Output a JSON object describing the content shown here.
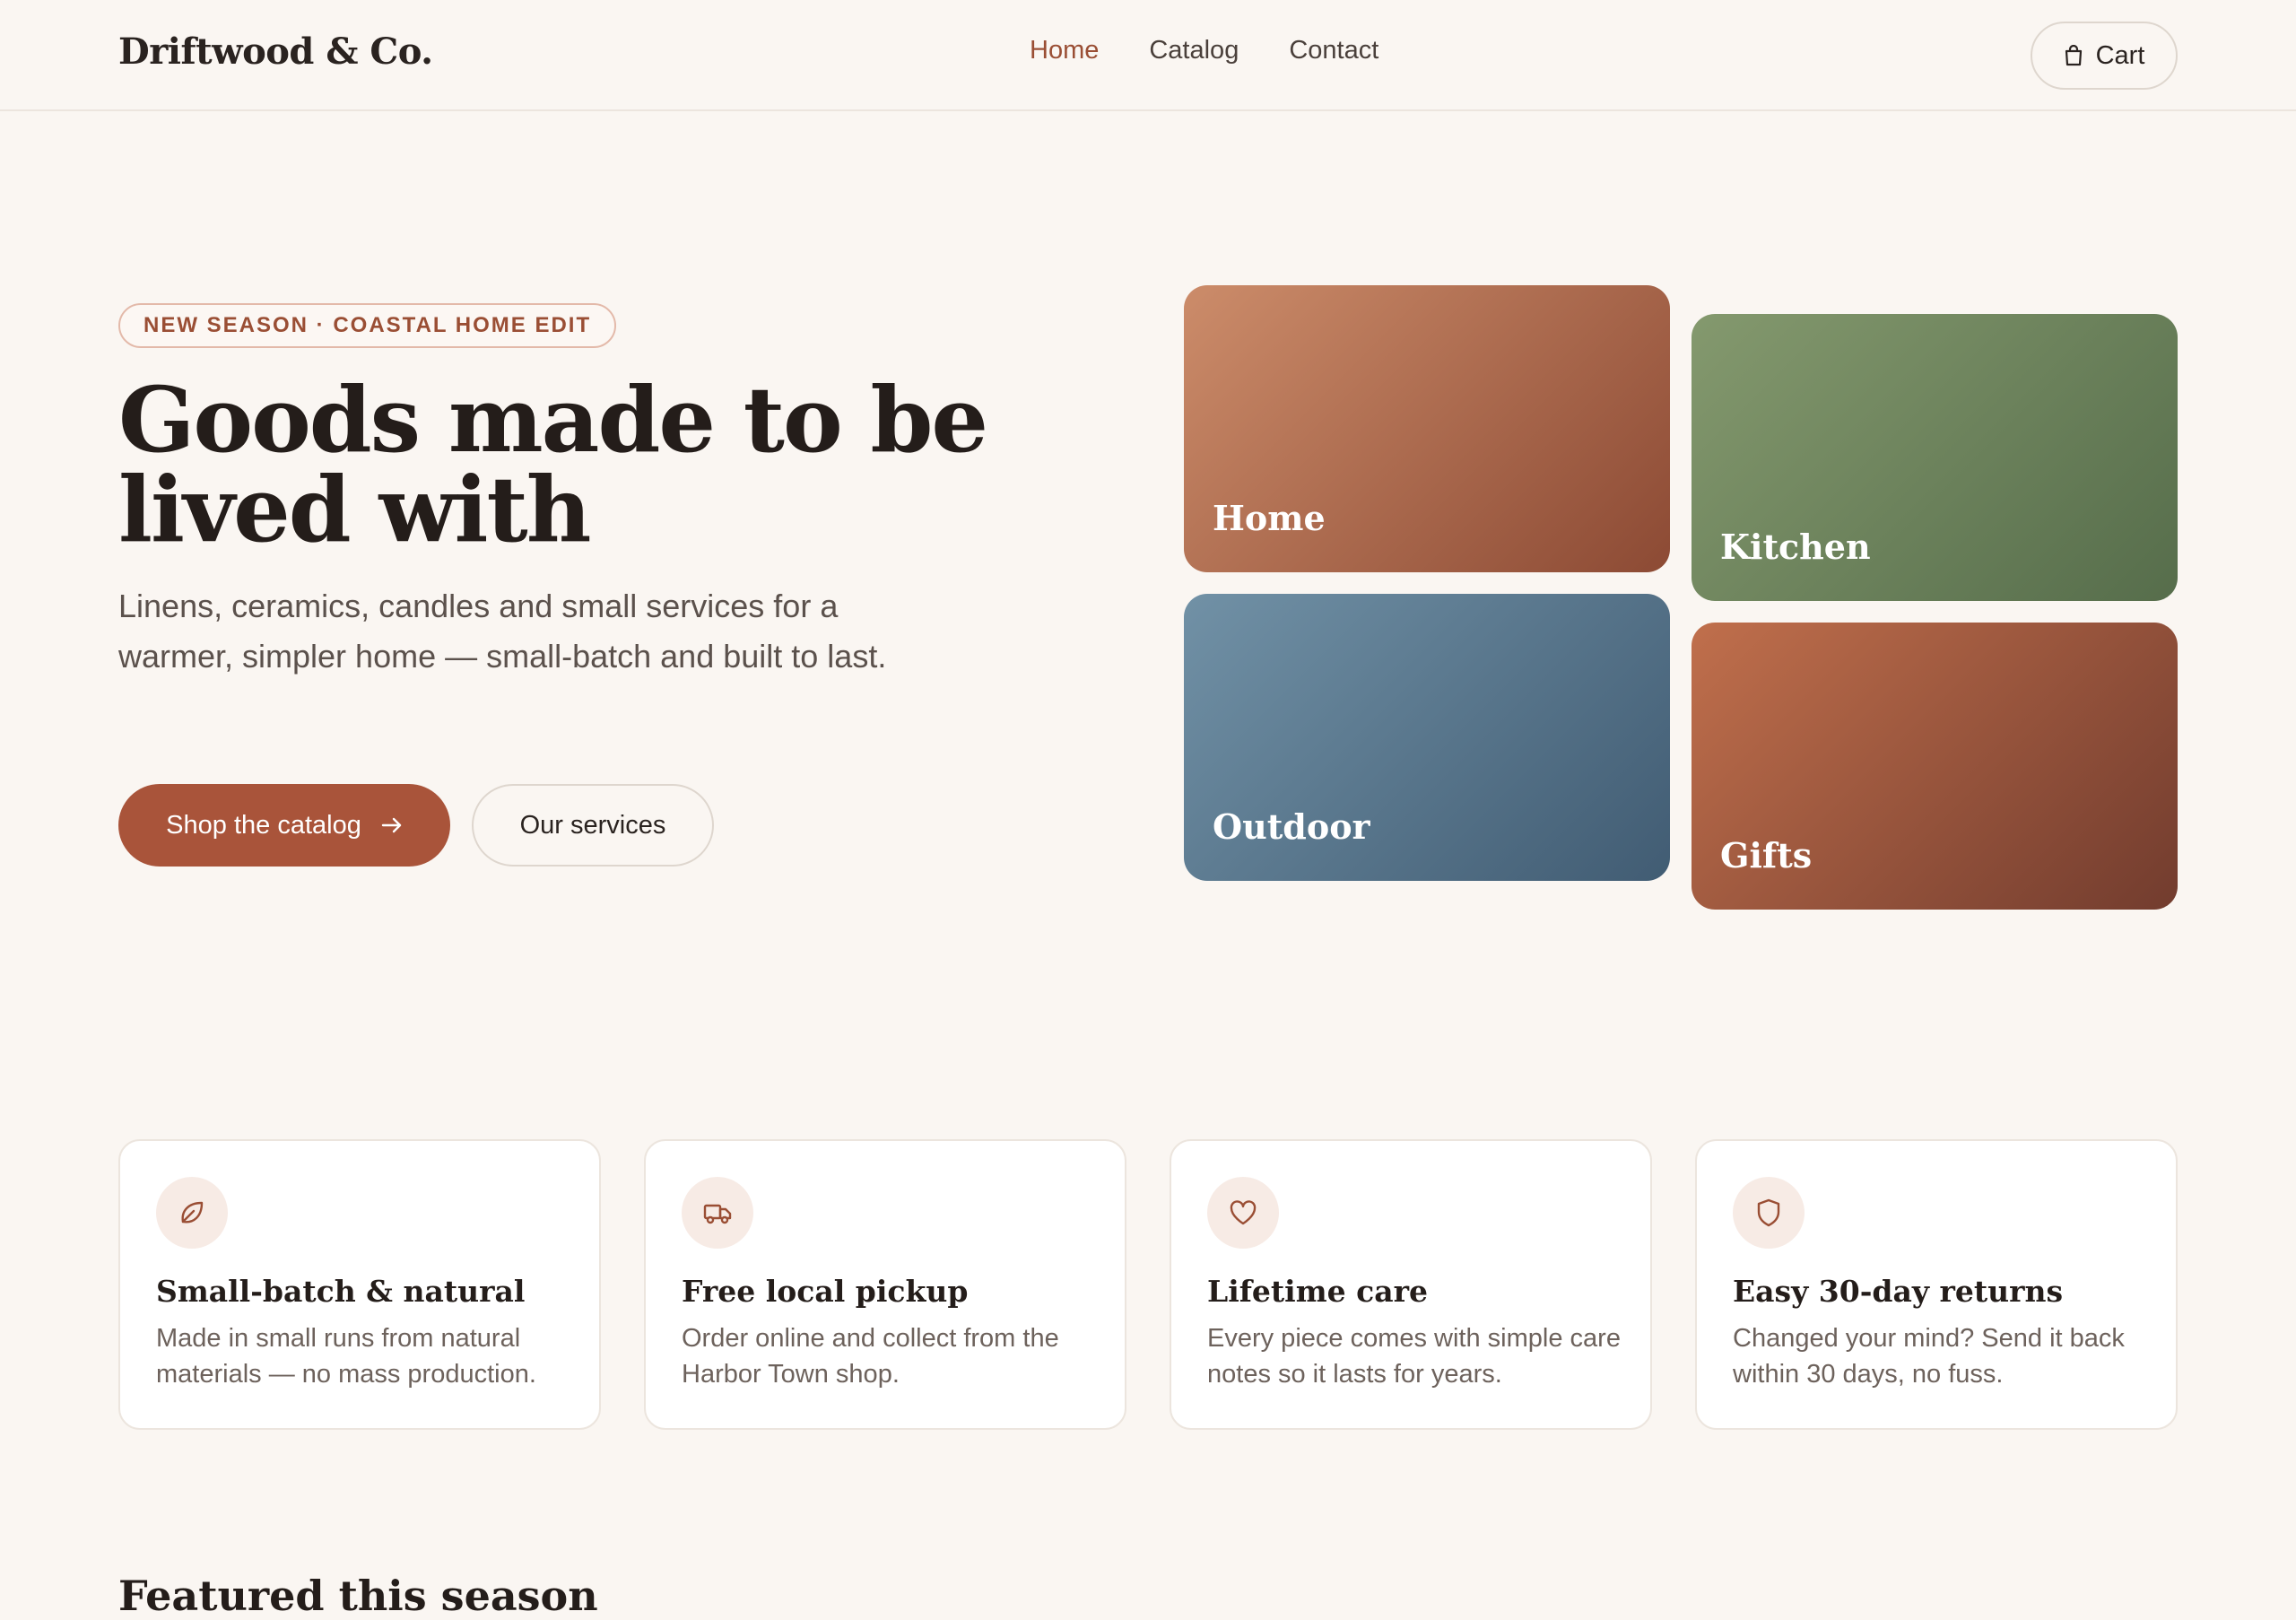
{
  "brand": {
    "name": "Driftwood & Co."
  },
  "nav": {
    "home": "Home",
    "catalog": "Catalog",
    "contact": "Contact"
  },
  "cart": {
    "label": "Cart"
  },
  "hero": {
    "badge": "NEW SEASON · COASTAL HOME EDIT",
    "title": "Goods made to be lived with",
    "subtitle": "Linens, ceramics, candles and small services for a warmer, simpler home — small-batch and built to last.",
    "primary_cta": "Shop the catalog",
    "secondary_cta": "Our services"
  },
  "categories": [
    {
      "label": "Home",
      "color": "#b06a4c"
    },
    {
      "label": "Kitchen",
      "color": "#6e8860"
    },
    {
      "label": "Outdoor",
      "color": "#58788f"
    },
    {
      "label": "Gifts",
      "color": "#9a523a"
    }
  ],
  "features": [
    {
      "icon": "leaf-icon",
      "title": "Small-batch & natural",
      "text": "Made in small runs from natural materials — no mass production."
    },
    {
      "icon": "truck-icon",
      "title": "Free local pickup",
      "text": "Order online and collect from the Harbor Town shop."
    },
    {
      "icon": "heart-icon",
      "title": "Lifetime care",
      "text": "Every piece comes with simple care notes so it lasts for years."
    },
    {
      "icon": "shield-icon",
      "title": "Easy 30-day returns",
      "text": "Changed your mind? Send it back within 30 days, no fuss."
    }
  ],
  "featured": {
    "title": "Featured this season"
  },
  "colors": {
    "accent": "#a9543a",
    "background": "#faf6f2",
    "text": "#241d1a"
  }
}
